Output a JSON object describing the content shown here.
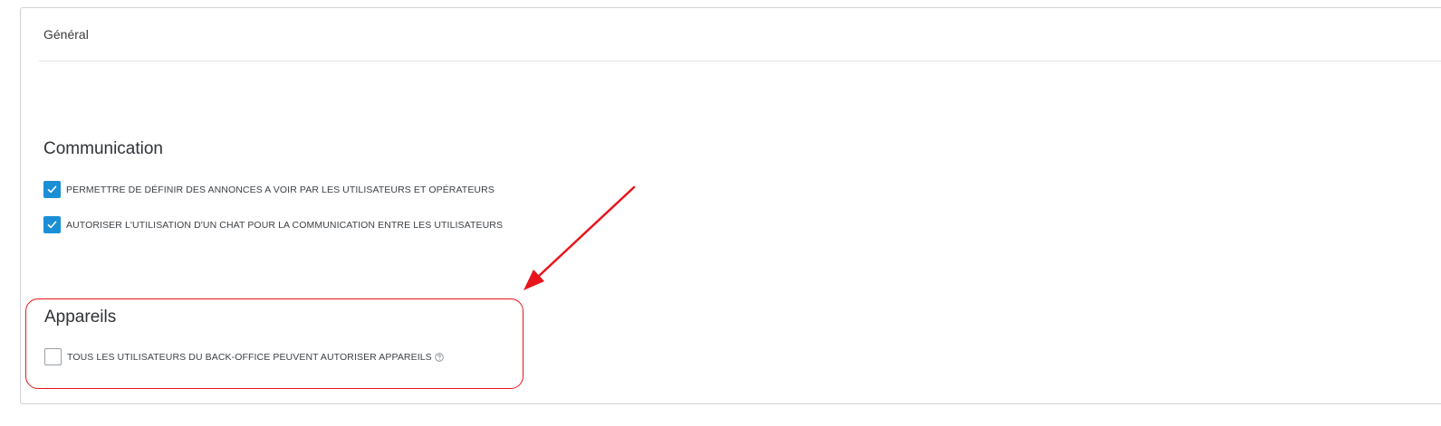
{
  "panel": {
    "title": "Général"
  },
  "communication": {
    "title": "Communication",
    "options": [
      {
        "label": "PERMETTRE DE DÉFINIR DES ANNONCES A VOIR PAR LES UTILISATEURS ET OPÉRATEURS",
        "checked": true
      },
      {
        "label": "AUTORISER L'UTILISATION D'UN CHAT POUR LA COMMUNICATION ENTRE LES UTILISATEURS",
        "checked": true
      }
    ]
  },
  "devices": {
    "title": "Appareils",
    "options": [
      {
        "label": "TOUS LES UTILISATEURS DU BACK-OFFICE PEUVENT AUTORISER APPAREILS",
        "checked": false,
        "icon": "help-circle-icon"
      }
    ]
  },
  "colors": {
    "checkbox_checked": "#1a8fd6",
    "annotation": "#e8141b"
  }
}
